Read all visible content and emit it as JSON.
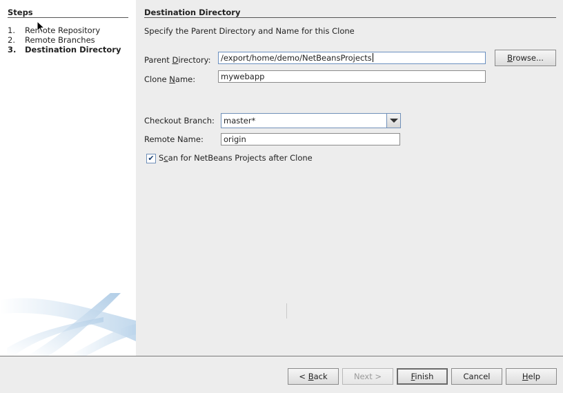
{
  "steps": {
    "title": "Steps",
    "items": [
      {
        "num": "1.",
        "label": "Remote Repository"
      },
      {
        "num": "2.",
        "label": "Remote Branches"
      },
      {
        "num": "3.",
        "label": "Destination Directory"
      }
    ]
  },
  "main": {
    "title": "Destination Directory",
    "description": "Specify the Parent Directory and Name for this Clone",
    "parent_directory": {
      "label_pre": "Parent ",
      "label_mnemonic": "D",
      "label_post": "irectory:",
      "value": "/export/home/demo/NetBeansProjects"
    },
    "browse_button": {
      "mnemonic": "B",
      "rest": "rowse..."
    },
    "clone_name": {
      "label_pre": "Clone ",
      "label_mnemonic": "N",
      "label_post": "ame:",
      "value": "mywebapp"
    },
    "checkout_branch": {
      "label": "Checkout Branch:",
      "value": "master*"
    },
    "remote_name": {
      "label": "Remote Name:",
      "value": "origin"
    },
    "scan_checkbox": {
      "checked": true,
      "check_glyph": "✔",
      "label_pre": "S",
      "label_mnemonic": "c",
      "label_post": "an for NetBeans Projects after Clone"
    }
  },
  "footer": {
    "back": {
      "prefix": "< ",
      "mnemonic": "B",
      "rest": "ack"
    },
    "next": {
      "label": "Next >",
      "enabled": false
    },
    "finish": {
      "mnemonic": "F",
      "rest": "inish"
    },
    "cancel": {
      "label": "Cancel"
    },
    "help": {
      "mnemonic": "H",
      "rest": "elp"
    }
  },
  "colors": {
    "accent_border": "#6f8fb8",
    "swoosh": "#c8ddee"
  }
}
